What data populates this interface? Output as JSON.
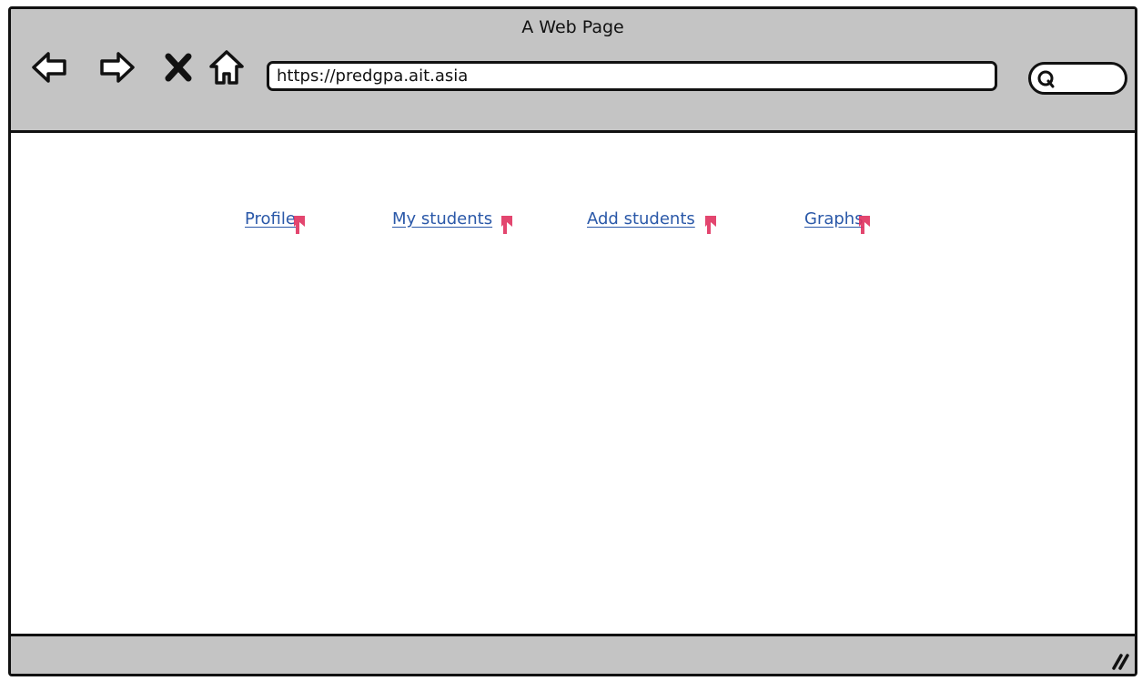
{
  "window": {
    "title": "A Web Page"
  },
  "toolbar": {
    "back_icon": "back-arrow-icon",
    "forward_icon": "forward-arrow-icon",
    "stop_icon": "close-x-icon",
    "home_icon": "home-icon",
    "url": "https://predgpa.ait.asia",
    "search_icon": "search-icon"
  },
  "nav": {
    "links": [
      {
        "label": "Profile"
      },
      {
        "label": "My students"
      },
      {
        "label": "Add students"
      },
      {
        "label": "Graphs"
      }
    ],
    "link_color": "#2a58a8",
    "marker_color": "#e0325f"
  },
  "colors": {
    "chrome": "#c4c4c4",
    "outline": "#111111",
    "page": "#ffffff"
  }
}
